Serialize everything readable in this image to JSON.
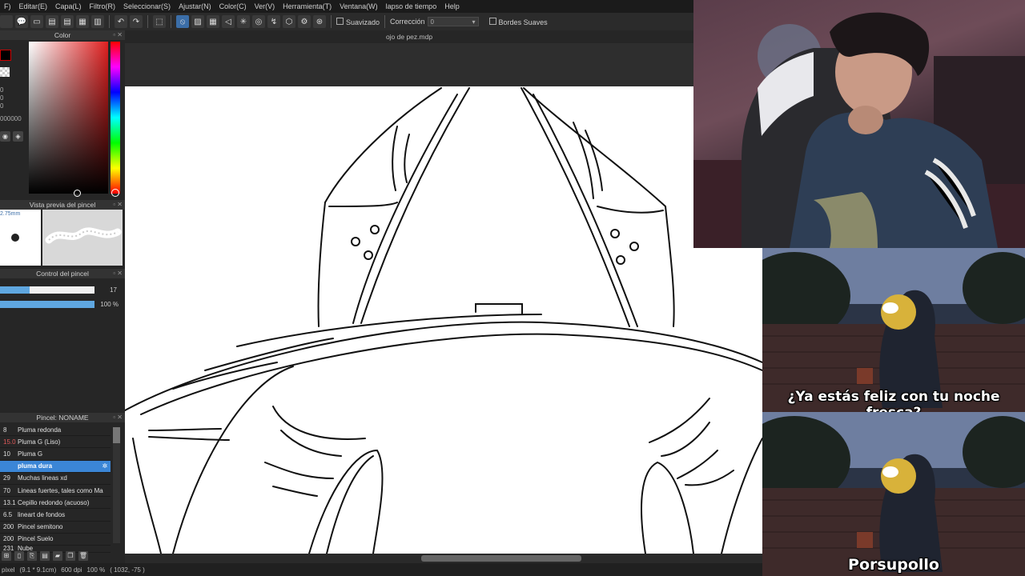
{
  "menu": [
    "F)",
    "Editar(E)",
    "Capa(L)",
    "Filtro(R)",
    "Seleccionar(S)",
    "Ajustar(N)",
    "Color(C)",
    "Ver(V)",
    "Herramienta(T)",
    "Ventana(W)",
    "lapso de tiempo",
    "Help"
  ],
  "toolbar": {
    "suavizado": "Suavizado",
    "correccion": "Corrección",
    "correccion_value": "0",
    "bordes": "Bordes Suaves"
  },
  "document": {
    "title": "ojo de pez.mdp"
  },
  "color_panel": {
    "title": "Color",
    "values": [
      "0",
      "0",
      "0"
    ],
    "hex": "000000"
  },
  "preview_panel": {
    "title": "Vista previa del pincel",
    "size": "2.75mm"
  },
  "control_panel": {
    "title": "Control del pincel",
    "size_value": "17",
    "size_fraction": 0.31,
    "opacity_value": "100 %",
    "opacity_fraction": 1.0
  },
  "brush_panel": {
    "title": "Pincel: NONAME",
    "brushes": [
      {
        "size": "8",
        "name": "Pluma redonda"
      },
      {
        "size": "15.0",
        "name": "Pluma G (Liso)"
      },
      {
        "size": "10",
        "name": "Pluma G"
      },
      {
        "size": "",
        "name": "pluma dura"
      },
      {
        "size": "29",
        "name": "Muchas lineas xd"
      },
      {
        "size": "70",
        "name": "Lineas fuertes, tales como Ma"
      },
      {
        "size": "13.1",
        "name": "Cepillo redondo (acuoso)"
      },
      {
        "size": "6.5",
        "name": "lineart de fondos"
      },
      {
        "size": "200",
        "name": "Pincel semitono"
      },
      {
        "size": "200",
        "name": "Pincel Suelo"
      },
      {
        "size": "231",
        "name": "Nube"
      }
    ],
    "selected_index": 3
  },
  "statusbar": {
    "pixel": "pixel",
    "dims": "(9.1 * 9.1cm)",
    "dpi": "600 dpi",
    "zoom": "100 %",
    "coords": "( 1032, -75 )"
  },
  "meme": {
    "caption_top": "¿Ya estás feliz con tu noche fresca?",
    "caption_bottom": "Porsupollo"
  },
  "colors": {
    "accent": "#3b86d6",
    "selected_row": "#3b86d6"
  }
}
